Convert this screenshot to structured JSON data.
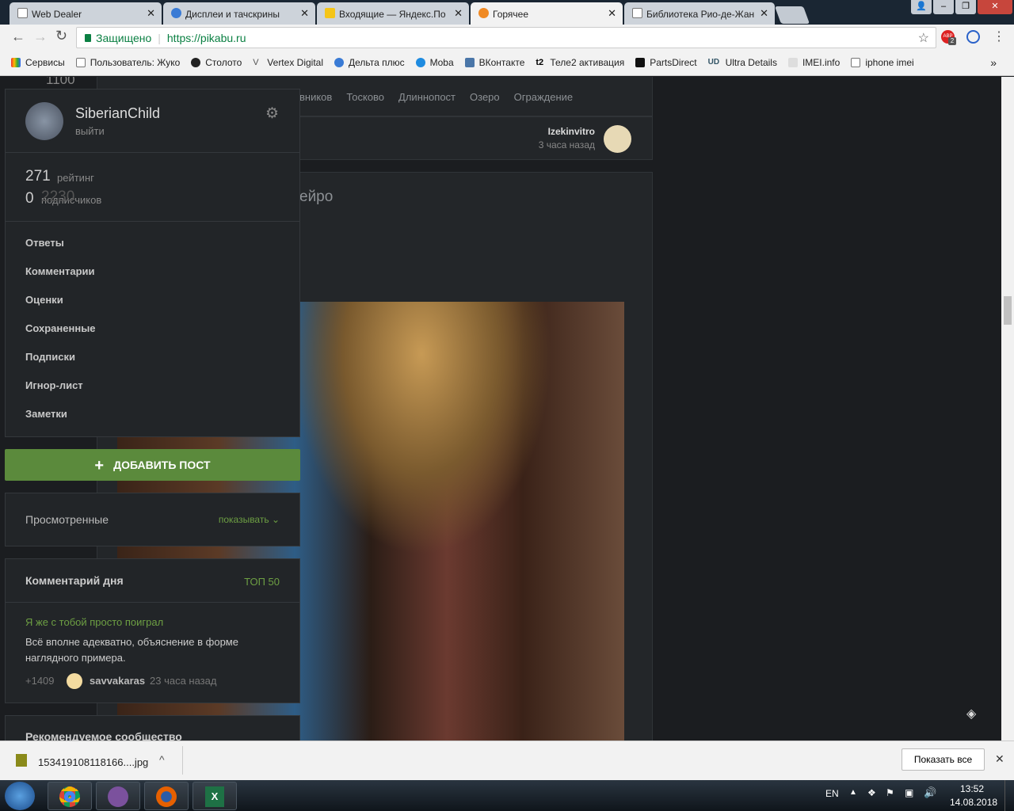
{
  "browser": {
    "tabs": [
      {
        "label": "Web Dealer"
      },
      {
        "label": "Дисплеи и тачскрины"
      },
      {
        "label": "Входящие — Яндекс.По"
      },
      {
        "label": "Горячее",
        "active": true
      },
      {
        "label": "Библиотека Рио-де-Жан"
      }
    ],
    "secure_label": "Защищено",
    "url": "https://pikabu.ru",
    "abp_badge": "2",
    "bookmarks": [
      "Сервисы",
      "Пользователь: Жуко",
      "Столото",
      "Vertex Digital",
      "Дельта плюс",
      "Moba",
      "ВКонтакте",
      "Теле2 активация",
      "PartsDirect",
      "Ultra Details",
      "IMEI.info",
      "iphone imei"
    ],
    "bookmarks_more": "»"
  },
  "page": {
    "tags": [
      "вников",
      "Тосково",
      "Длиннопост",
      "Озеро",
      "Ограждение"
    ],
    "post_author": "Izekinvitro",
    "post_time": "3 часа назад",
    "post_title_fragment": "ейро",
    "overlay_rating": "1100",
    "overlay_count": "2230"
  },
  "sidebar": {
    "username": "SiberianChild",
    "logout": "выйти",
    "rating_value": "271",
    "rating_label": "рейтинг",
    "subscribers_value": "0",
    "subscribers_label": "подписчиков",
    "menu": [
      "Ответы",
      "Комментарии",
      "Оценки",
      "Сохраненные",
      "Подписки",
      "Игнор-лист",
      "Заметки"
    ],
    "add_post": "ДОБАВИТЬ ПОСТ",
    "viewed_label": "Просмотренные",
    "viewed_toggle": "показывать",
    "comment_day": {
      "title": "Комментарий дня",
      "top_link": "ТОП 50",
      "post_link": "Я же с тобой просто поиграл",
      "text": "Всё вполне адекватно, объяснение в форме наглядного примера.",
      "score": "+1409",
      "author": "savvakaras",
      "time": "23 часа назад"
    },
    "recommended": "Рекомендуемое сообщество"
  },
  "downloads": {
    "file": "153419108118166....jpg",
    "show_all": "Показать все"
  },
  "taskbar": {
    "lang": "EN",
    "time": "13:52",
    "date": "14.08.2018"
  },
  "colors": {
    "accent": "#6d9f43",
    "button": "#5b8a3c"
  }
}
